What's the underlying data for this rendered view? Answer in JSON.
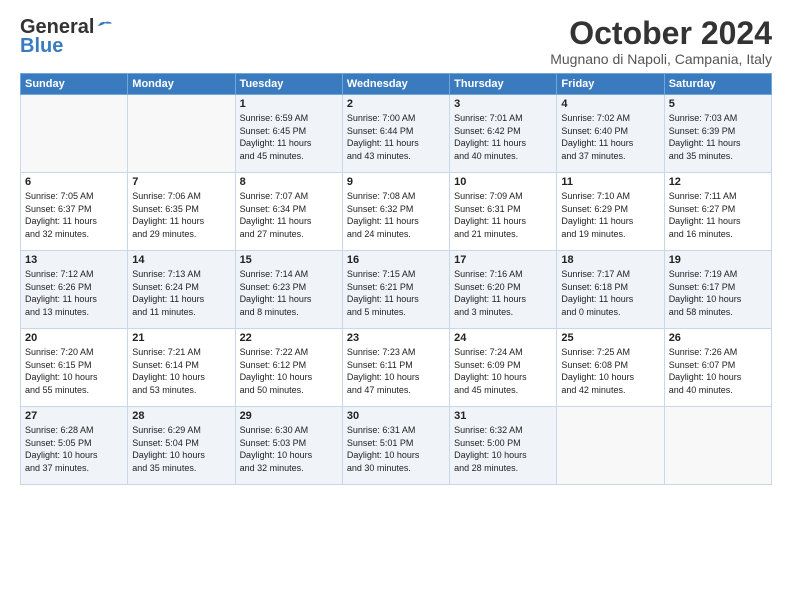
{
  "header": {
    "logo_line1": "General",
    "logo_line2": "Blue",
    "month": "October 2024",
    "location": "Mugnano di Napoli, Campania, Italy"
  },
  "days_of_week": [
    "Sunday",
    "Monday",
    "Tuesday",
    "Wednesday",
    "Thursday",
    "Friday",
    "Saturday"
  ],
  "weeks": [
    [
      {
        "day": "",
        "info": ""
      },
      {
        "day": "",
        "info": ""
      },
      {
        "day": "1",
        "info": "Sunrise: 6:59 AM\nSunset: 6:45 PM\nDaylight: 11 hours\nand 45 minutes."
      },
      {
        "day": "2",
        "info": "Sunrise: 7:00 AM\nSunset: 6:44 PM\nDaylight: 11 hours\nand 43 minutes."
      },
      {
        "day": "3",
        "info": "Sunrise: 7:01 AM\nSunset: 6:42 PM\nDaylight: 11 hours\nand 40 minutes."
      },
      {
        "day": "4",
        "info": "Sunrise: 7:02 AM\nSunset: 6:40 PM\nDaylight: 11 hours\nand 37 minutes."
      },
      {
        "day": "5",
        "info": "Sunrise: 7:03 AM\nSunset: 6:39 PM\nDaylight: 11 hours\nand 35 minutes."
      }
    ],
    [
      {
        "day": "6",
        "info": "Sunrise: 7:05 AM\nSunset: 6:37 PM\nDaylight: 11 hours\nand 32 minutes."
      },
      {
        "day": "7",
        "info": "Sunrise: 7:06 AM\nSunset: 6:35 PM\nDaylight: 11 hours\nand 29 minutes."
      },
      {
        "day": "8",
        "info": "Sunrise: 7:07 AM\nSunset: 6:34 PM\nDaylight: 11 hours\nand 27 minutes."
      },
      {
        "day": "9",
        "info": "Sunrise: 7:08 AM\nSunset: 6:32 PM\nDaylight: 11 hours\nand 24 minutes."
      },
      {
        "day": "10",
        "info": "Sunrise: 7:09 AM\nSunset: 6:31 PM\nDaylight: 11 hours\nand 21 minutes."
      },
      {
        "day": "11",
        "info": "Sunrise: 7:10 AM\nSunset: 6:29 PM\nDaylight: 11 hours\nand 19 minutes."
      },
      {
        "day": "12",
        "info": "Sunrise: 7:11 AM\nSunset: 6:27 PM\nDaylight: 11 hours\nand 16 minutes."
      }
    ],
    [
      {
        "day": "13",
        "info": "Sunrise: 7:12 AM\nSunset: 6:26 PM\nDaylight: 11 hours\nand 13 minutes."
      },
      {
        "day": "14",
        "info": "Sunrise: 7:13 AM\nSunset: 6:24 PM\nDaylight: 11 hours\nand 11 minutes."
      },
      {
        "day": "15",
        "info": "Sunrise: 7:14 AM\nSunset: 6:23 PM\nDaylight: 11 hours\nand 8 minutes."
      },
      {
        "day": "16",
        "info": "Sunrise: 7:15 AM\nSunset: 6:21 PM\nDaylight: 11 hours\nand 5 minutes."
      },
      {
        "day": "17",
        "info": "Sunrise: 7:16 AM\nSunset: 6:20 PM\nDaylight: 11 hours\nand 3 minutes."
      },
      {
        "day": "18",
        "info": "Sunrise: 7:17 AM\nSunset: 6:18 PM\nDaylight: 11 hours\nand 0 minutes."
      },
      {
        "day": "19",
        "info": "Sunrise: 7:19 AM\nSunset: 6:17 PM\nDaylight: 10 hours\nand 58 minutes."
      }
    ],
    [
      {
        "day": "20",
        "info": "Sunrise: 7:20 AM\nSunset: 6:15 PM\nDaylight: 10 hours\nand 55 minutes."
      },
      {
        "day": "21",
        "info": "Sunrise: 7:21 AM\nSunset: 6:14 PM\nDaylight: 10 hours\nand 53 minutes."
      },
      {
        "day": "22",
        "info": "Sunrise: 7:22 AM\nSunset: 6:12 PM\nDaylight: 10 hours\nand 50 minutes."
      },
      {
        "day": "23",
        "info": "Sunrise: 7:23 AM\nSunset: 6:11 PM\nDaylight: 10 hours\nand 47 minutes."
      },
      {
        "day": "24",
        "info": "Sunrise: 7:24 AM\nSunset: 6:09 PM\nDaylight: 10 hours\nand 45 minutes."
      },
      {
        "day": "25",
        "info": "Sunrise: 7:25 AM\nSunset: 6:08 PM\nDaylight: 10 hours\nand 42 minutes."
      },
      {
        "day": "26",
        "info": "Sunrise: 7:26 AM\nSunset: 6:07 PM\nDaylight: 10 hours\nand 40 minutes."
      }
    ],
    [
      {
        "day": "27",
        "info": "Sunrise: 6:28 AM\nSunset: 5:05 PM\nDaylight: 10 hours\nand 37 minutes."
      },
      {
        "day": "28",
        "info": "Sunrise: 6:29 AM\nSunset: 5:04 PM\nDaylight: 10 hours\nand 35 minutes."
      },
      {
        "day": "29",
        "info": "Sunrise: 6:30 AM\nSunset: 5:03 PM\nDaylight: 10 hours\nand 32 minutes."
      },
      {
        "day": "30",
        "info": "Sunrise: 6:31 AM\nSunset: 5:01 PM\nDaylight: 10 hours\nand 30 minutes."
      },
      {
        "day": "31",
        "info": "Sunrise: 6:32 AM\nSunset: 5:00 PM\nDaylight: 10 hours\nand 28 minutes."
      },
      {
        "day": "",
        "info": ""
      },
      {
        "day": "",
        "info": ""
      }
    ]
  ]
}
